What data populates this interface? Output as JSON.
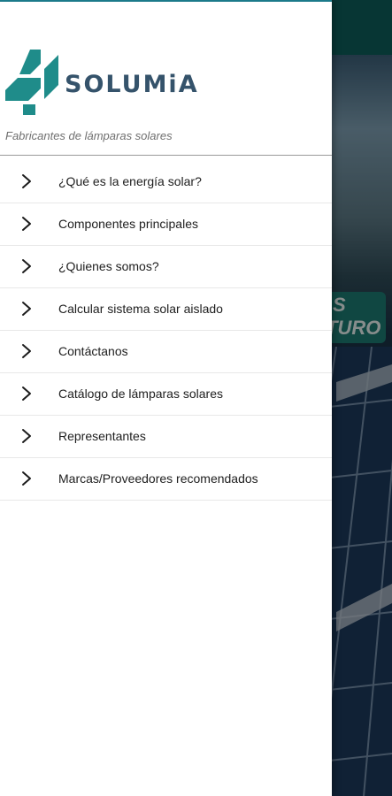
{
  "brand": {
    "name": "SOLUMiA",
    "tagline": "Fabricantes de lámparas solares"
  },
  "background": {
    "badge_line1": "S",
    "badge_line2": "TURO"
  },
  "menu": {
    "items": [
      {
        "label": "¿Qué es la energía solar?"
      },
      {
        "label": "Componentes principales"
      },
      {
        "label": "¿Quienes somos?"
      },
      {
        "label": "Calcular sistema solar aislado"
      },
      {
        "label": "Contáctanos"
      },
      {
        "label": "Catálogo de lámparas solares"
      },
      {
        "label": "Representantes"
      },
      {
        "label": "Marcas/Proveedores recomendados"
      }
    ]
  },
  "colors": {
    "brand_teal": "#1f8c8a",
    "brand_text": "#35536b",
    "chevron": "#1a1a1a"
  },
  "icons": {
    "logo": "solumia-logo",
    "chevron": "chevron-right-icon"
  }
}
